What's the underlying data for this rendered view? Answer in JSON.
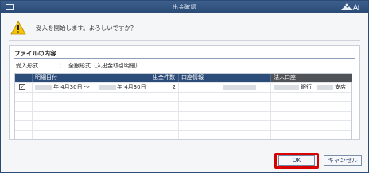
{
  "window": {
    "title": "出金確認"
  },
  "message": {
    "text": "受入を開始します。よろしいですか？"
  },
  "panel": {
    "title": "ファイルの内容",
    "format_label": "受入形式",
    "format_colon": "：",
    "format_value": "全銀形式（入出金取引明細）"
  },
  "table": {
    "headers": [
      "",
      "明細日付",
      "出金件数",
      "口座情報",
      "法人口座"
    ],
    "rows": [
      {
        "checked": "✓",
        "date_from": "年 4月30日 ～",
        "date_to": "年 4月30日",
        "count": "2",
        "bank_suffix": "銀行",
        "branch_suffix": "支店"
      }
    ]
  },
  "buttons": {
    "ok": "OK",
    "cancel": "キャンセル"
  },
  "colors": {
    "accent": "#2c4c79",
    "highlight": "#d90000"
  },
  "icons": {
    "warning": "warning-icon",
    "window": "window-icon",
    "logo": "brand-logo"
  }
}
